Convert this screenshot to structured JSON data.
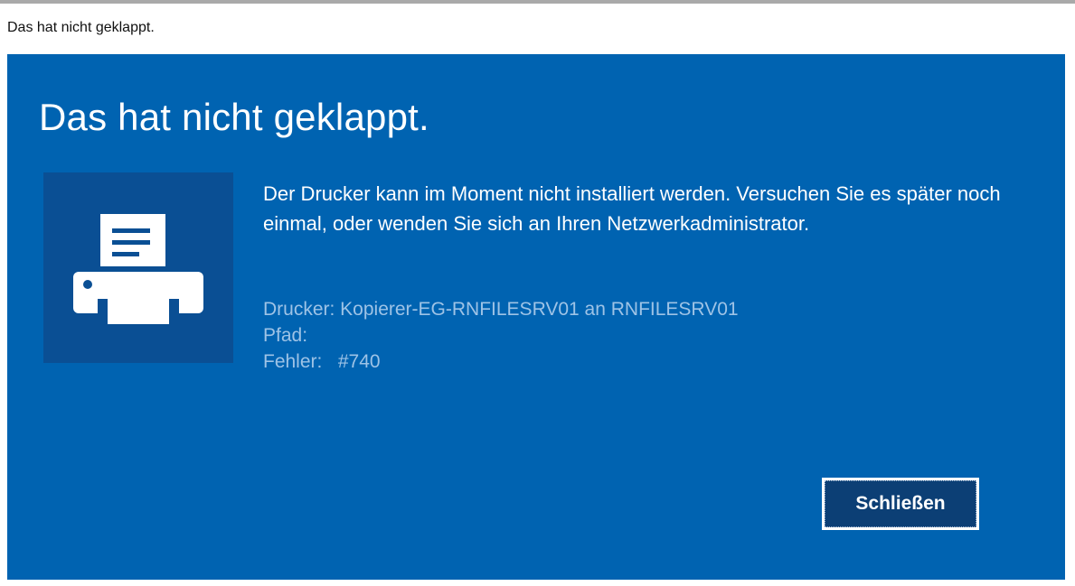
{
  "window": {
    "title": "Das hat nicht geklappt."
  },
  "dialog": {
    "heading": "Das hat nicht geklappt.",
    "icon": "printer-icon",
    "message": "Der Drucker kann im Moment nicht installiert werden. Versuchen Sie es später noch einmal, oder wenden Sie sich an Ihren Netzwerkadministrator.",
    "details": {
      "printer": "Drucker: Kopierer-EG-RNFILESRV01 an RNFILESRV01",
      "path": "Pfad:",
      "error": "Fehler:   #740"
    },
    "close_label": "Schließen"
  },
  "colors": {
    "panel_background": "#0063b1",
    "icon_tile_background": "#0a4f94",
    "details_text": "#9ec3e6",
    "button_background": "#0c3f75"
  }
}
